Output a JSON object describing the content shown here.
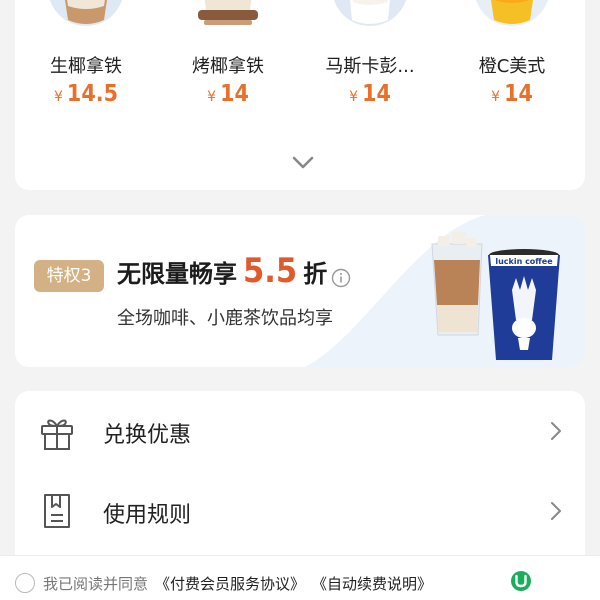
{
  "products": [
    {
      "name": "生椰拿铁",
      "currency": "¥",
      "price": "14.5"
    },
    {
      "name": "烤椰拿铁",
      "currency": "¥",
      "price": "14"
    },
    {
      "name": "马斯卡彭...",
      "currency": "¥",
      "price": "14"
    },
    {
      "name": "橙C美式",
      "currency": "¥",
      "price": "14"
    }
  ],
  "privilege": {
    "badge": "特权3",
    "title_prefix": "无限量畅享",
    "discount": "5.5",
    "title_suffix": "折",
    "subtitle": "全场咖啡、小鹿茶饮品均享",
    "cup_brand": "luckin coffee"
  },
  "menu": [
    {
      "label": "兑换优惠",
      "icon": "gift-icon"
    },
    {
      "label": "使用规则",
      "icon": "document-icon"
    }
  ],
  "agreement": {
    "prefix": "我已阅读并同意",
    "link1": "《付费会员服务协议》",
    "link2": "《自动续费说明》"
  },
  "colors": {
    "price": "#e8702a",
    "discount": "#e25a2c",
    "badge": "#d4b184",
    "brand_green": "#1aad5c"
  }
}
